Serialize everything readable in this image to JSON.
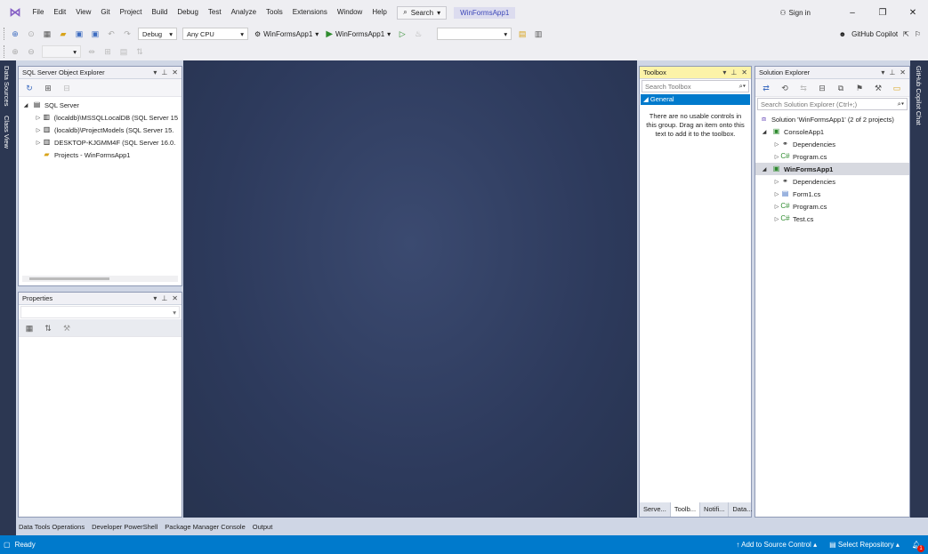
{
  "menu": [
    "File",
    "Edit",
    "View",
    "Git",
    "Project",
    "Build",
    "Debug",
    "Test",
    "Analyze",
    "Tools",
    "Extensions",
    "Window",
    "Help"
  ],
  "search_label": "Search",
  "project_name": "WinFormsApp1",
  "sign_in": "Sign in",
  "config": "Debug",
  "platform": "Any CPU",
  "startup_project": "WinFormsApp1",
  "run_target": "WinFormsApp1",
  "copilot": "GitHub Copilot",
  "left_rail_tabs": [
    "Data Sources",
    "Class View"
  ],
  "right_rail_tab": "GitHub Copilot Chat",
  "sql_explorer": {
    "title": "SQL Server Object Explorer",
    "root": "SQL Server",
    "servers": [
      "(localdb)\\MSSQLLocalDB (SQL Server 15",
      "(localdb)\\ProjectModels (SQL Server 15.",
      "DESKTOP-KJGMM4F (SQL Server 16.0."
    ],
    "projects": "Projects - WinFormsApp1"
  },
  "properties": {
    "title": "Properties"
  },
  "toolbox": {
    "title": "Toolbox",
    "search_placeholder": "Search Toolbox",
    "group": "General",
    "empty_message": "There are no usable controls in this group. Drag an item onto this text to add it to the toolbox.",
    "tabs": [
      "Serve...",
      "Toolb...",
      "Notifi...",
      "Data..."
    ]
  },
  "solution_explorer": {
    "title": "Solution Explorer",
    "search_placeholder": "Search Solution Explorer (Ctrl+;)",
    "solution": "Solution 'WinFormsApp1' (2 of 2 projects)",
    "project1": "ConsoleApp1",
    "p1_dependencies": "Dependencies",
    "p1_program": "Program.cs",
    "project2": "WinFormsApp1",
    "p2_dependencies": "Dependencies",
    "p2_form": "Form1.cs",
    "p2_program": "Program.cs",
    "p2_test": "Test.cs"
  },
  "bottom_tabs": [
    "Data Tools Operations",
    "Developer PowerShell",
    "Package Manager Console",
    "Output"
  ],
  "status": {
    "ready": "Ready",
    "source_control": "Add to Source Control",
    "repository": "Select Repository",
    "notifications": "1"
  },
  "colors": {
    "accent": "#007acc",
    "editor_bg": "#2d3a5c",
    "selection": "#007acc"
  }
}
